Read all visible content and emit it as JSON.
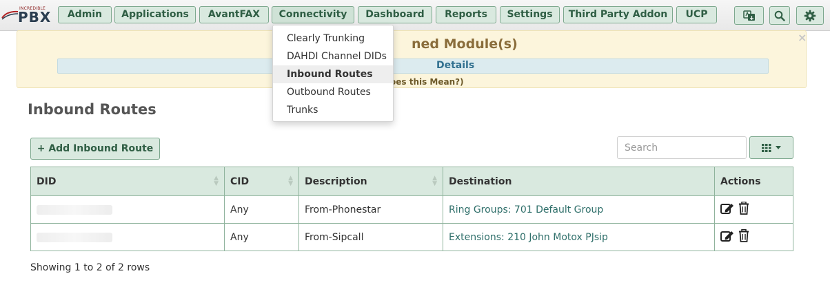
{
  "app": {
    "logo_small": "INCREDIBLE",
    "logo_big": "PBX"
  },
  "nav": {
    "items": [
      {
        "label": "Admin"
      },
      {
        "label": "Applications"
      },
      {
        "label": "AvantFAX"
      },
      {
        "label": "Connectivity"
      },
      {
        "label": "Dashboard"
      },
      {
        "label": "Reports"
      },
      {
        "label": "Settings"
      },
      {
        "label": "Third Party Addon"
      },
      {
        "label": "UCP"
      }
    ],
    "icons": [
      "language-icon",
      "search-icon",
      "gear-icon"
    ]
  },
  "dropdown": {
    "items": [
      {
        "label": "Clearly Trunking"
      },
      {
        "label": "DAHDI Channel DIDs"
      },
      {
        "label": "Inbound Routes"
      },
      {
        "label": "Outbound Routes"
      },
      {
        "label": "Trunks"
      }
    ],
    "active": "Inbound Routes"
  },
  "alert": {
    "title_visible": "ned Module(s)",
    "details": "Details",
    "sub_visible": "oes this Mean?)",
    "close": "×"
  },
  "page": {
    "title": "Inbound Routes",
    "add_button": "+ Add Inbound Route",
    "search_placeholder": "Search"
  },
  "table": {
    "columns": [
      "DID",
      "CID",
      "Description",
      "Destination",
      "Actions"
    ],
    "rows": [
      {
        "did": "",
        "cid": "Any",
        "description": "From-Phonestar",
        "destination": "Ring Groups: 701 Default Group"
      },
      {
        "did": "",
        "cid": "Any",
        "description": "From-Sipcall",
        "destination": "Extensions: 210 John Motox PJsip"
      }
    ]
  },
  "footer": {
    "text": "Showing 1 to 2 of 2 rows"
  },
  "colors": {
    "accent": "#d9e9df",
    "accent_border": "#7da88e",
    "accent_text": "#2f5e44",
    "alert_bg": "#fcf5dc",
    "link": "#2f6f6a"
  }
}
